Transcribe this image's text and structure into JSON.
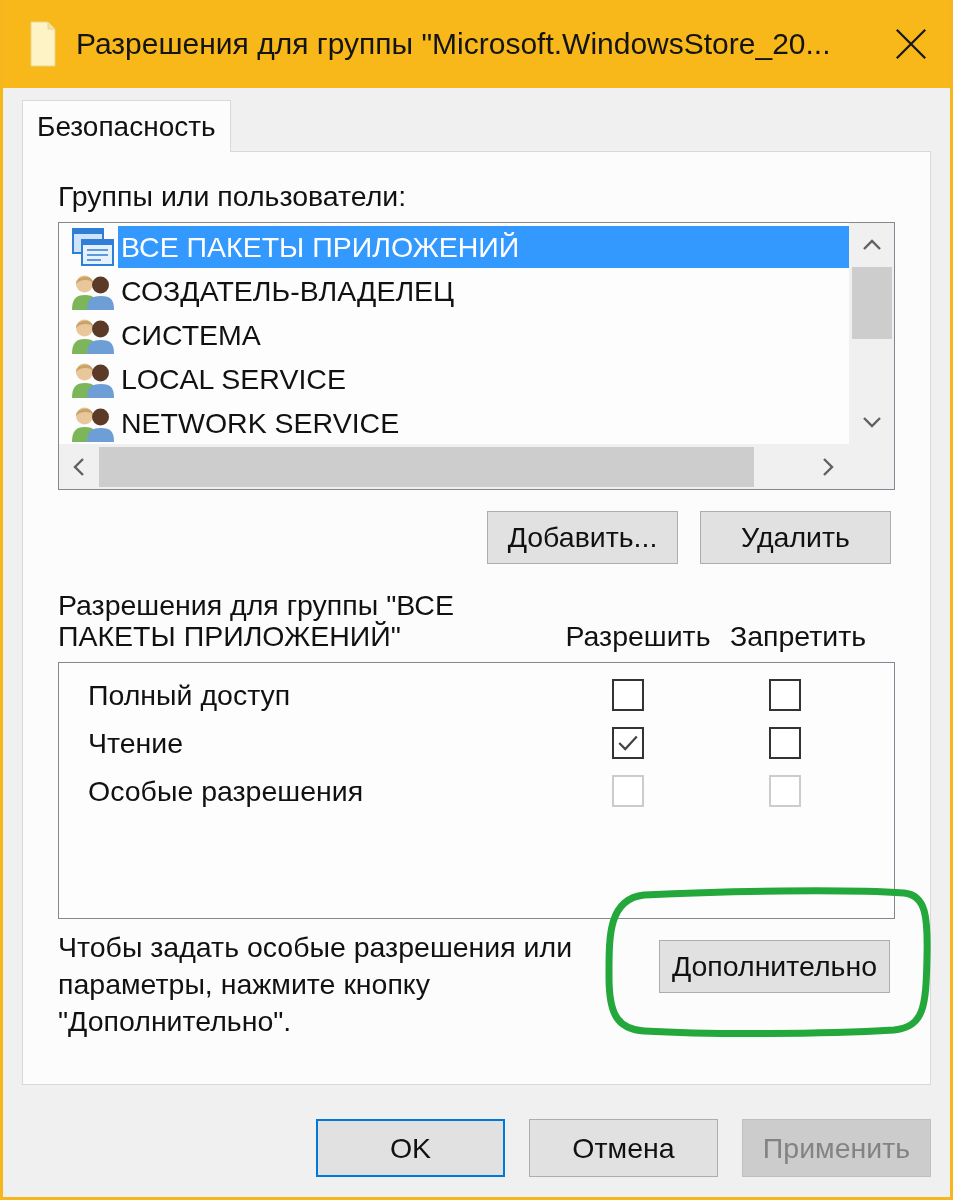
{
  "window": {
    "title": "Разрешения для группы \"Microsoft.WindowsStore_20..."
  },
  "tabs": [
    {
      "label": "Безопасность",
      "selected": true
    }
  ],
  "groups": {
    "label": "Группы или пользователи:",
    "items": [
      {
        "name": "ВСЕ ПАКЕТЫ ПРИЛОЖЕНИЙ",
        "kind": "package",
        "selected": true
      },
      {
        "name": "СОЗДАТЕЛЬ-ВЛАДЕЛЕЦ",
        "kind": "group",
        "selected": false
      },
      {
        "name": "СИСТЕМА",
        "kind": "group",
        "selected": false
      },
      {
        "name": "LOCAL SERVICE",
        "kind": "group",
        "selected": false
      },
      {
        "name": "NETWORK SERVICE",
        "kind": "group",
        "selected": false
      }
    ],
    "buttons": [
      {
        "label": "Добавить..."
      },
      {
        "label": "Удалить"
      }
    ]
  },
  "permissions": {
    "title": "Разрешения для группы \"ВСЕ ПАКЕТЫ ПРИЛОЖЕНИЙ\"",
    "columns": [
      "Разрешить",
      "Запретить"
    ],
    "rows": [
      {
        "name": "Полный доступ",
        "allow": {
          "checked": false,
          "disabled": false
        },
        "deny": {
          "checked": false,
          "disabled": false
        }
      },
      {
        "name": "Чтение",
        "allow": {
          "checked": true,
          "disabled": false
        },
        "deny": {
          "checked": false,
          "disabled": false
        }
      },
      {
        "name": "Особые разрешения",
        "allow": {
          "checked": false,
          "disabled": true
        },
        "deny": {
          "checked": false,
          "disabled": true
        }
      }
    ]
  },
  "advanced": {
    "hint": "Чтобы задать особые разрешения или параметры, нажмите кнопку \"Дополнительно\".",
    "button": "Дополнительно",
    "highlighted": true
  },
  "buttons": [
    {
      "label": "OK",
      "default": true,
      "disabled": false
    },
    {
      "label": "Отмена",
      "default": false,
      "disabled": false
    },
    {
      "label": "Применить",
      "default": false,
      "disabled": true
    }
  ]
}
